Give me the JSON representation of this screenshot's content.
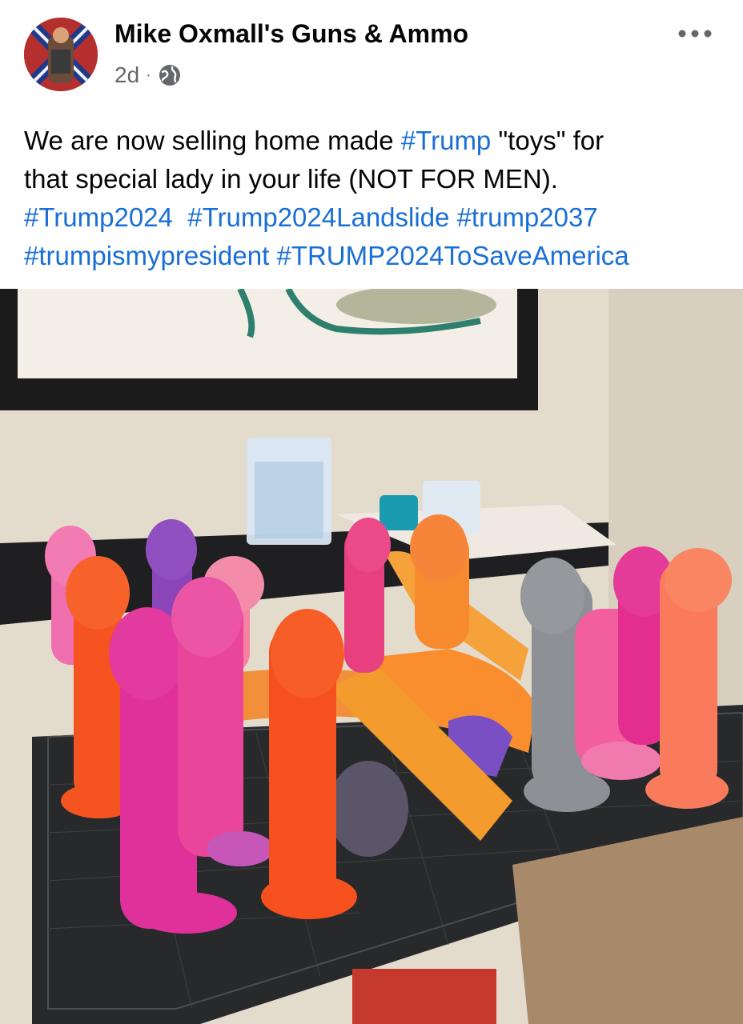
{
  "post": {
    "author": "Mike Oxmall's Guns & Ammo",
    "time": "2d",
    "separator": "·",
    "privacy_icon": "globe-icon",
    "more_icon": "more-options-icon",
    "caption": {
      "line1_text": "We are now selling home made ",
      "line1_tag": "#Trump",
      "line1_rest": " \"toys\" for",
      "line2_text": "that special lady in your life (NOT FOR MEN).",
      "tags_line3": [
        "#Trump2024",
        "#Trump2024Landslide",
        "#trump2037"
      ],
      "tags_line4": [
        "#trumpismypresident",
        "#TRUMP2024ToSaveAmerica"
      ]
    }
  },
  "colors": {
    "hashtag": "#1a6fd6",
    "text": "#050505",
    "meta": "#65676b"
  }
}
